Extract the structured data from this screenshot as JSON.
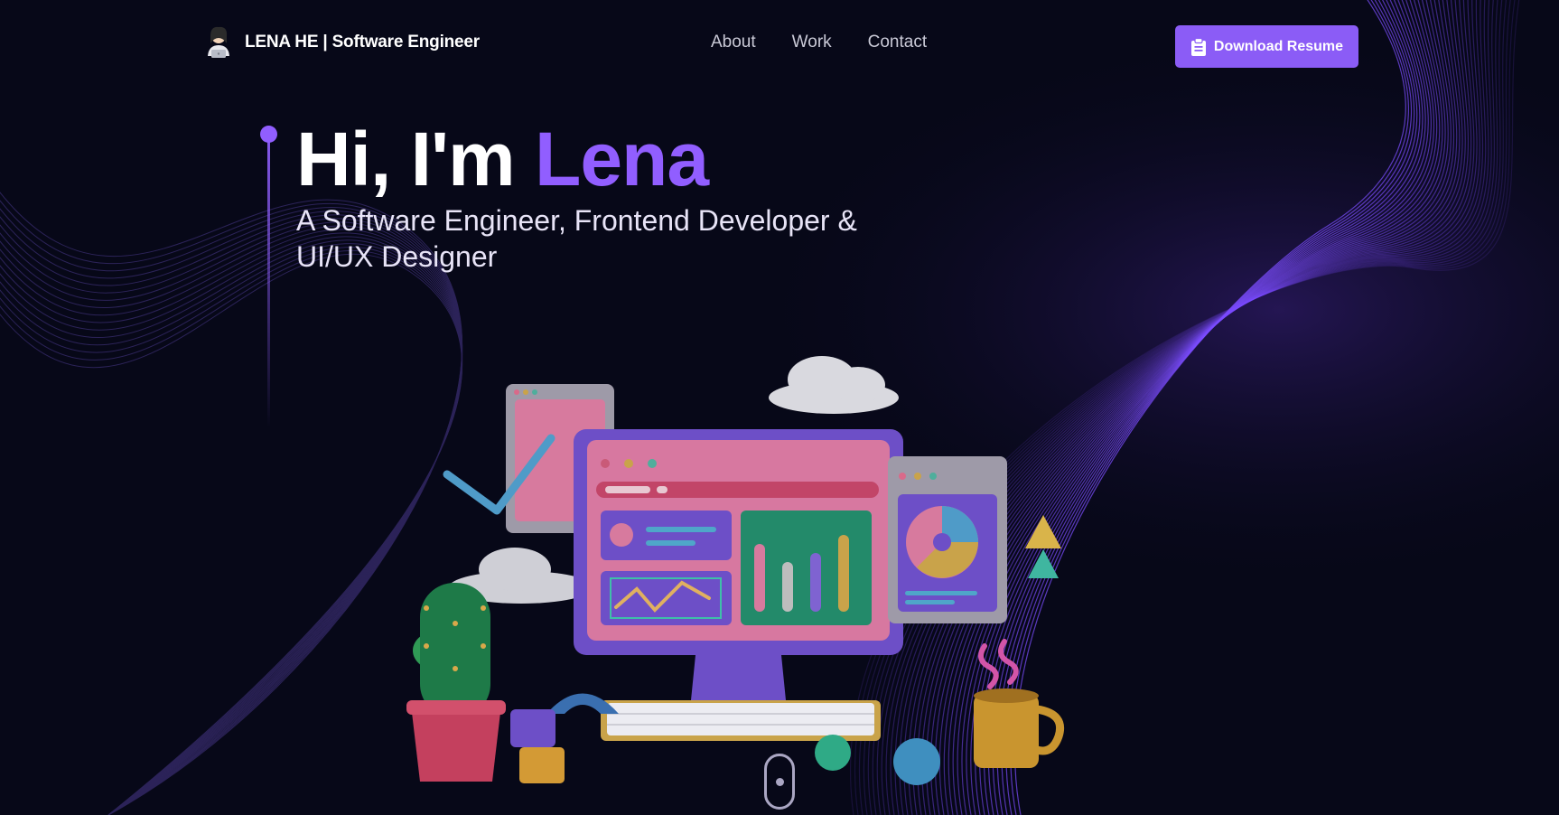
{
  "header": {
    "logo_text": "LENA HE  | Software Engineer",
    "nav": [
      "About",
      "Work",
      "Contact"
    ],
    "resume_label": "Download Resume"
  },
  "hero": {
    "greeting": "Hi, I'm ",
    "name": "Lena",
    "subtitle": "A Software Engineer, Frontend Developer & UI/UX Designer"
  },
  "colors": {
    "accent": "#915eff",
    "button": "#8b5cf6",
    "background": "#070818"
  },
  "icons": [
    "avatar-icon",
    "clipboard-icon",
    "mouse-scroll-icon"
  ]
}
